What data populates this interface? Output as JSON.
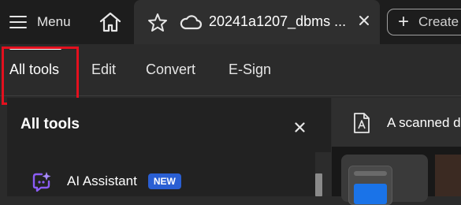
{
  "topbar": {
    "menu_label": "Menu",
    "tab_title": "20241a1207_dbms ...",
    "create_label": "Create"
  },
  "tools_tabs": [
    {
      "label": "All tools"
    },
    {
      "label": "Edit"
    },
    {
      "label": "Convert"
    },
    {
      "label": "E-Sign"
    }
  ],
  "panel": {
    "title": "All tools",
    "ai_assistant_label": "AI Assistant",
    "new_badge": "NEW"
  },
  "notice": {
    "text": "A scanned d"
  },
  "colors": {
    "highlight": "#e3101e",
    "badge": "#2a5fd3",
    "ai_icon": "#8b5cf6"
  },
  "icons": [
    "hamburger-icon",
    "home-icon",
    "star-icon",
    "cloud-icon",
    "close-icon",
    "plus-icon",
    "ai-assistant-icon",
    "document-a-icon"
  ]
}
